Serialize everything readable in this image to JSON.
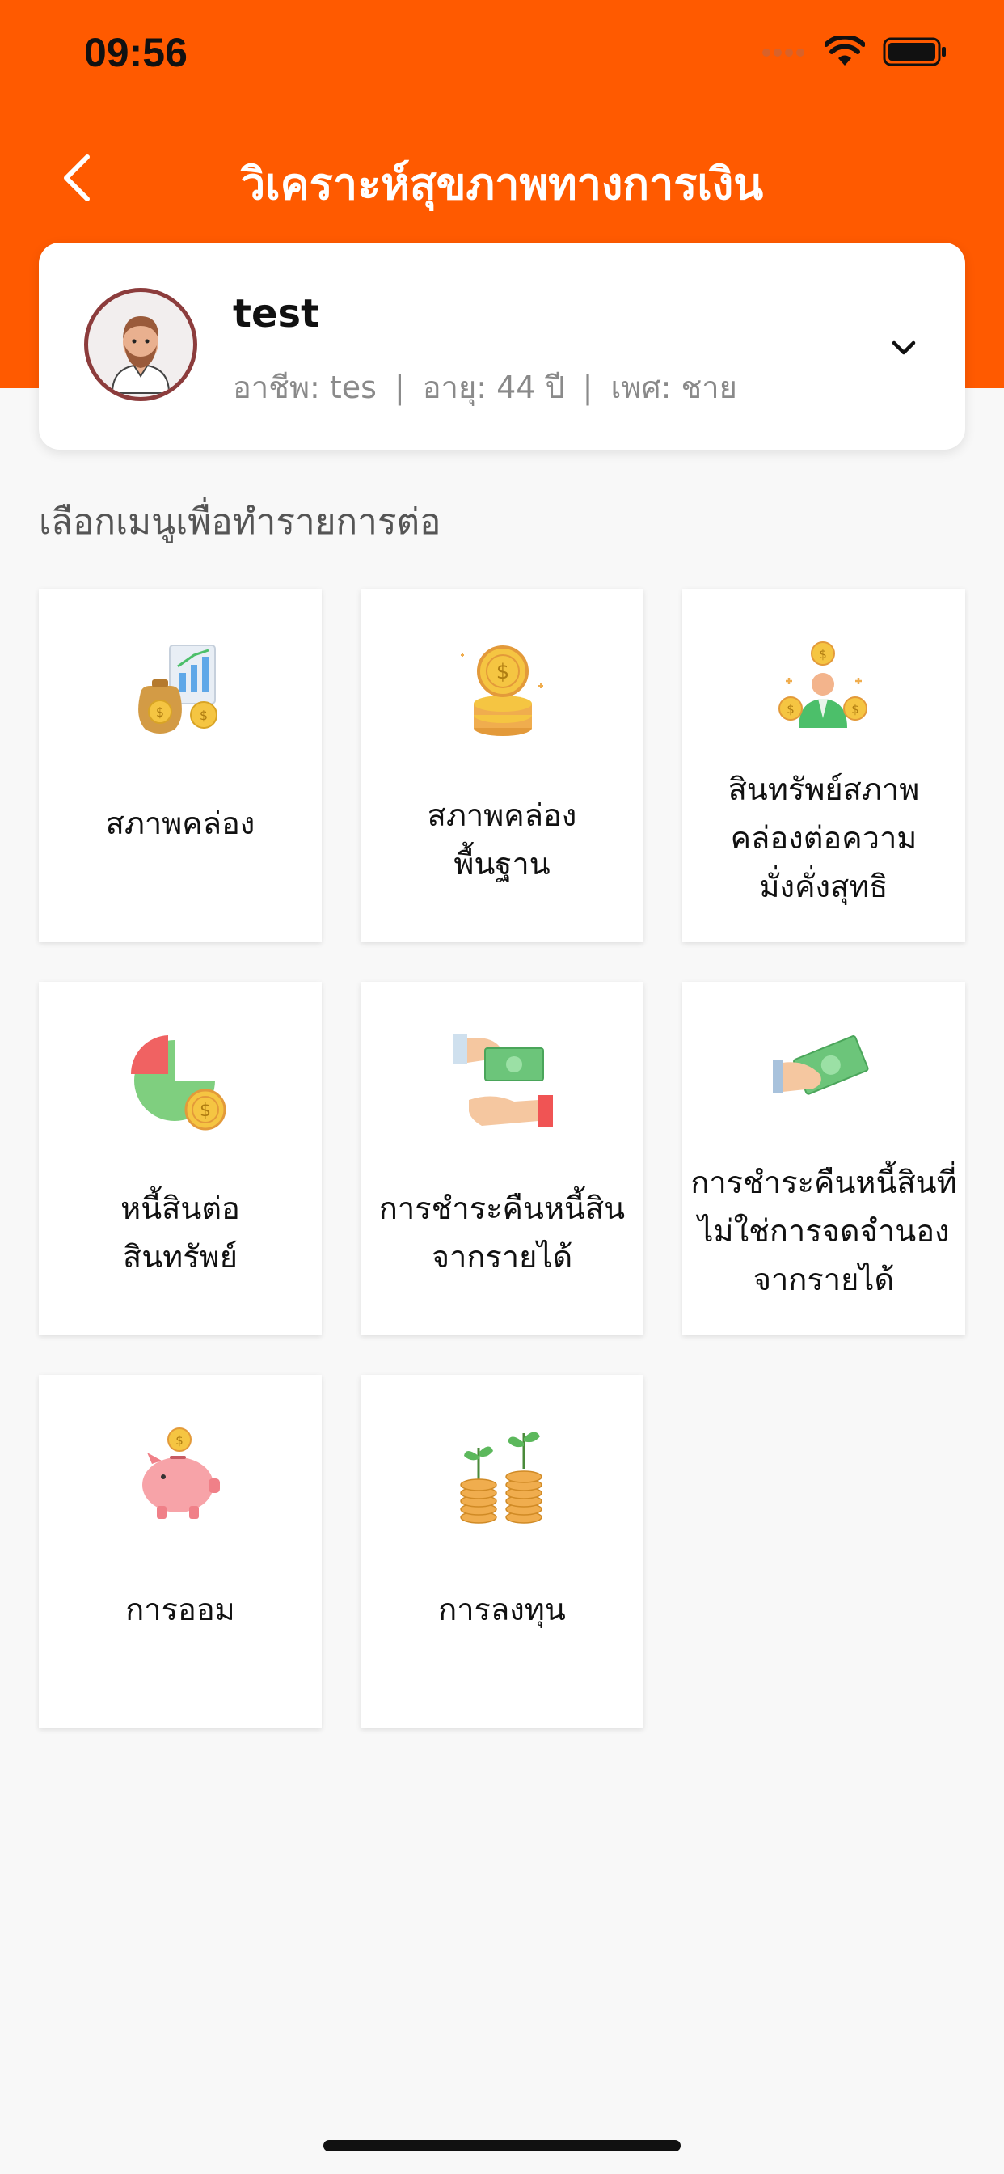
{
  "status_bar": {
    "time": "09:56"
  },
  "nav": {
    "title": "วิเคราะห์สุขภาพทางการเงิน"
  },
  "profile": {
    "name": "test",
    "occupation": "อาชีพ: tes",
    "age": "อายุ: 44 ปี",
    "gender": "เพศ: ชาย",
    "separator": "|"
  },
  "menu": {
    "heading": "เลือกเมนูเพื่อทำรายการต่อ",
    "items": [
      {
        "label": "สภาพคล่อง",
        "icon": "money-bag-report-icon"
      },
      {
        "label": "สภาพคล่อง\nพื้นฐาน",
        "icon": "coins-stack-icon"
      },
      {
        "label": "สินทรัพย์สภาพ\nคล่องต่อความ\nมั่งคั่งสุทธิ",
        "icon": "person-coins-icon"
      },
      {
        "label": "หนี้สินต่อ\nสินทรัพย์",
        "icon": "pie-chart-coin-icon"
      },
      {
        "label": "การชำระคืนหนี้สิน\nจากรายได้",
        "icon": "hand-over-cash-icon"
      },
      {
        "label": "การชำระคืนหนี้สินที่\nไม่ใช่การจดจำนอง\nจากรายได้",
        "icon": "hand-cash-icon"
      },
      {
        "label": "การออม",
        "icon": "piggy-bank-icon"
      },
      {
        "label": "การลงทุน",
        "icon": "coins-plant-icon"
      }
    ]
  },
  "colors": {
    "brand": "#ff5a00",
    "background": "#f8f8f8"
  }
}
